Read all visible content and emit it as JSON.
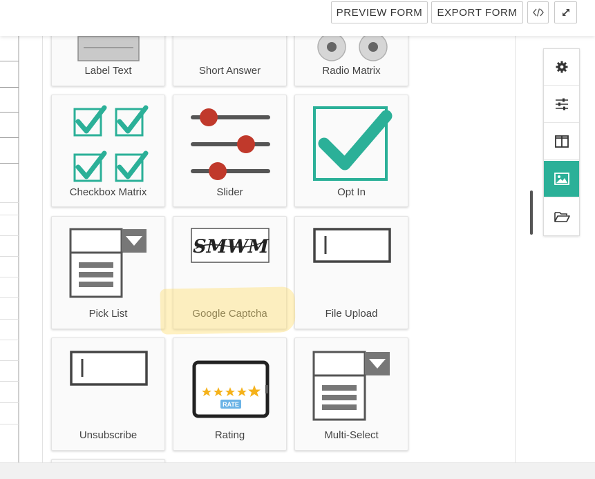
{
  "toolbar": {
    "preview_label": "PREVIEW FORM",
    "export_label": "EXPORT FORM"
  },
  "fields": [
    {
      "label": "Label Text",
      "icon": "label-text-icon"
    },
    {
      "label": "Short Answer",
      "icon": "short-answer-icon"
    },
    {
      "label": "Radio Matrix",
      "icon": "radio-matrix-icon"
    },
    {
      "label": "Checkbox Matrix",
      "icon": "checkbox-matrix-icon"
    },
    {
      "label": "Slider",
      "icon": "slider-icon"
    },
    {
      "label": "Opt In",
      "icon": "opt-in-icon"
    },
    {
      "label": "Pick List",
      "icon": "pick-list-icon"
    },
    {
      "label": "Google Captcha",
      "icon": "captcha-icon",
      "captcha_text": "SMWM"
    },
    {
      "label": "File Upload",
      "icon": "file-upload-icon"
    },
    {
      "label": "Unsubscribe",
      "icon": "unsubscribe-icon"
    },
    {
      "label": "Rating",
      "icon": "rating-icon",
      "badge": "RATE"
    },
    {
      "label": "Multi-Select",
      "icon": "multi-select-icon"
    }
  ],
  "side_toolbar": [
    {
      "icon": "gear-icon",
      "active": false
    },
    {
      "icon": "sliders-icon",
      "active": false
    },
    {
      "icon": "columns-icon",
      "active": false
    },
    {
      "icon": "image-icon",
      "active": true
    },
    {
      "icon": "folder-open-icon",
      "active": false
    }
  ],
  "colors": {
    "teal": "#2bb098",
    "slider_knob": "#c0392b",
    "star": "#f5b21b",
    "highlight": "#ffdd6e"
  }
}
